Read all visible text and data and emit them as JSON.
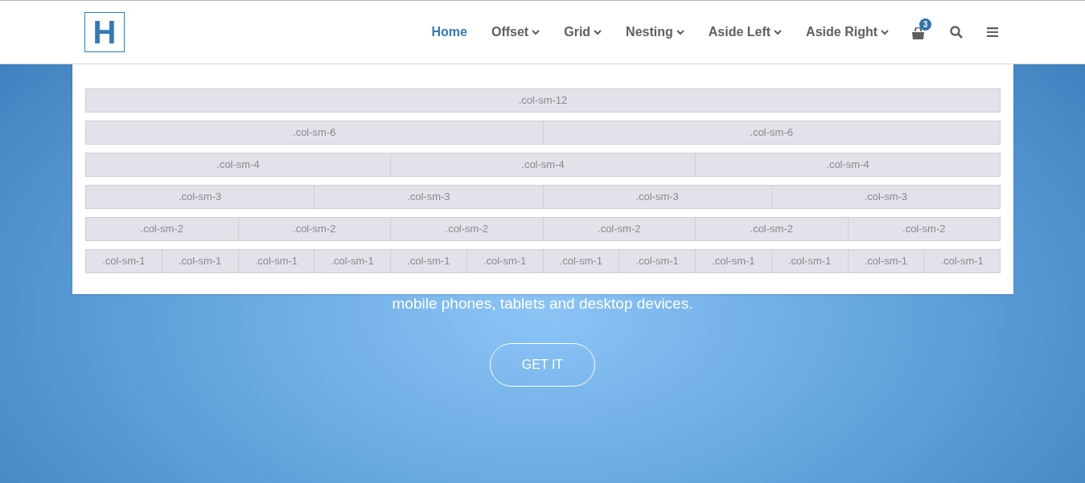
{
  "logo": {
    "letter": "H"
  },
  "nav": [
    {
      "label": "Home",
      "selected": true,
      "dropdown": false
    },
    {
      "label": "Offset",
      "selected": false,
      "dropdown": true
    },
    {
      "label": "Grid",
      "selected": false,
      "dropdown": true
    },
    {
      "label": "Nesting",
      "selected": false,
      "dropdown": true
    },
    {
      "label": "Aside Left",
      "selected": false,
      "dropdown": true
    },
    {
      "label": "Aside Right",
      "selected": false,
      "dropdown": true
    }
  ],
  "cart": {
    "badge": "3"
  },
  "grid_menu": {
    "rows": [
      {
        "blocks": [
          ".col-sm-12"
        ]
      },
      {
        "blocks": [
          ".col-sm-6",
          ".col-sm-6"
        ]
      },
      {
        "blocks": [
          ".col-sm-4",
          ".col-sm-4",
          ".col-sm-4"
        ]
      },
      {
        "blocks": [
          ".col-sm-3",
          ".col-sm-3",
          ".col-sm-3",
          ".col-sm-3"
        ]
      },
      {
        "blocks": [
          ".col-sm-2",
          ".col-sm-2",
          ".col-sm-2",
          ".col-sm-2",
          ".col-sm-2",
          ".col-sm-2"
        ]
      },
      {
        "blocks": [
          ".col-sm-1",
          ".col-sm-1",
          ".col-sm-1",
          ".col-sm-1",
          ".col-sm-1",
          ".col-sm-1",
          ".col-sm-1",
          ".col-sm-1",
          ".col-sm-1",
          ".col-sm-1",
          ".col-sm-1",
          ".col-sm-1"
        ]
      }
    ]
  },
  "hero": {
    "text": "mobile phones, tablets and desktop devices.",
    "button": "GET IT"
  }
}
